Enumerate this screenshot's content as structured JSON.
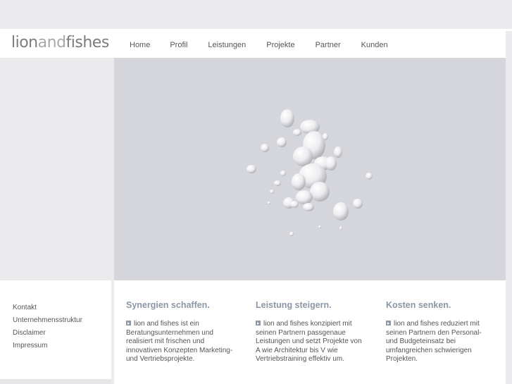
{
  "brand": {
    "part1": "lion",
    "part2": "and",
    "part3": "fishes"
  },
  "nav": {
    "items": [
      {
        "label": "Home"
      },
      {
        "label": "Profil"
      },
      {
        "label": "Leistungen"
      },
      {
        "label": "Projekte"
      },
      {
        "label": "Partner"
      },
      {
        "label": "Kunden"
      }
    ]
  },
  "footer_links": [
    {
      "label": "Kontakt"
    },
    {
      "label": "Unternehmensstruktur"
    },
    {
      "label": "Disclaimer"
    },
    {
      "label": "Impressum"
    }
  ],
  "columns": [
    {
      "title": "Synergien schaffen.",
      "text": "lion and fishes ist ein Beratungsunternehmen und realisiert mit frischen und innovativen Konzepten Marketing- und Vertriebsprojekte."
    },
    {
      "title": "Leistung steigern.",
      "text": "lion and fishes konzipiert mit seinen Partnern passgenaue Leistungen und setzt Projekte von A wie Architektur bis V wie Vertriebstraining effektiv um."
    },
    {
      "title": "Kosten senken.",
      "text": "lion and fishes reduziert mit seinen Partnern den Personal- und Budgeteinsatz bei umfangreichen schwierigen Projekten."
    }
  ],
  "colors": {
    "accent": "#8c96a5",
    "hero_background": "#d5d6dc",
    "page_background": "#ebebed",
    "text": "#555555"
  }
}
